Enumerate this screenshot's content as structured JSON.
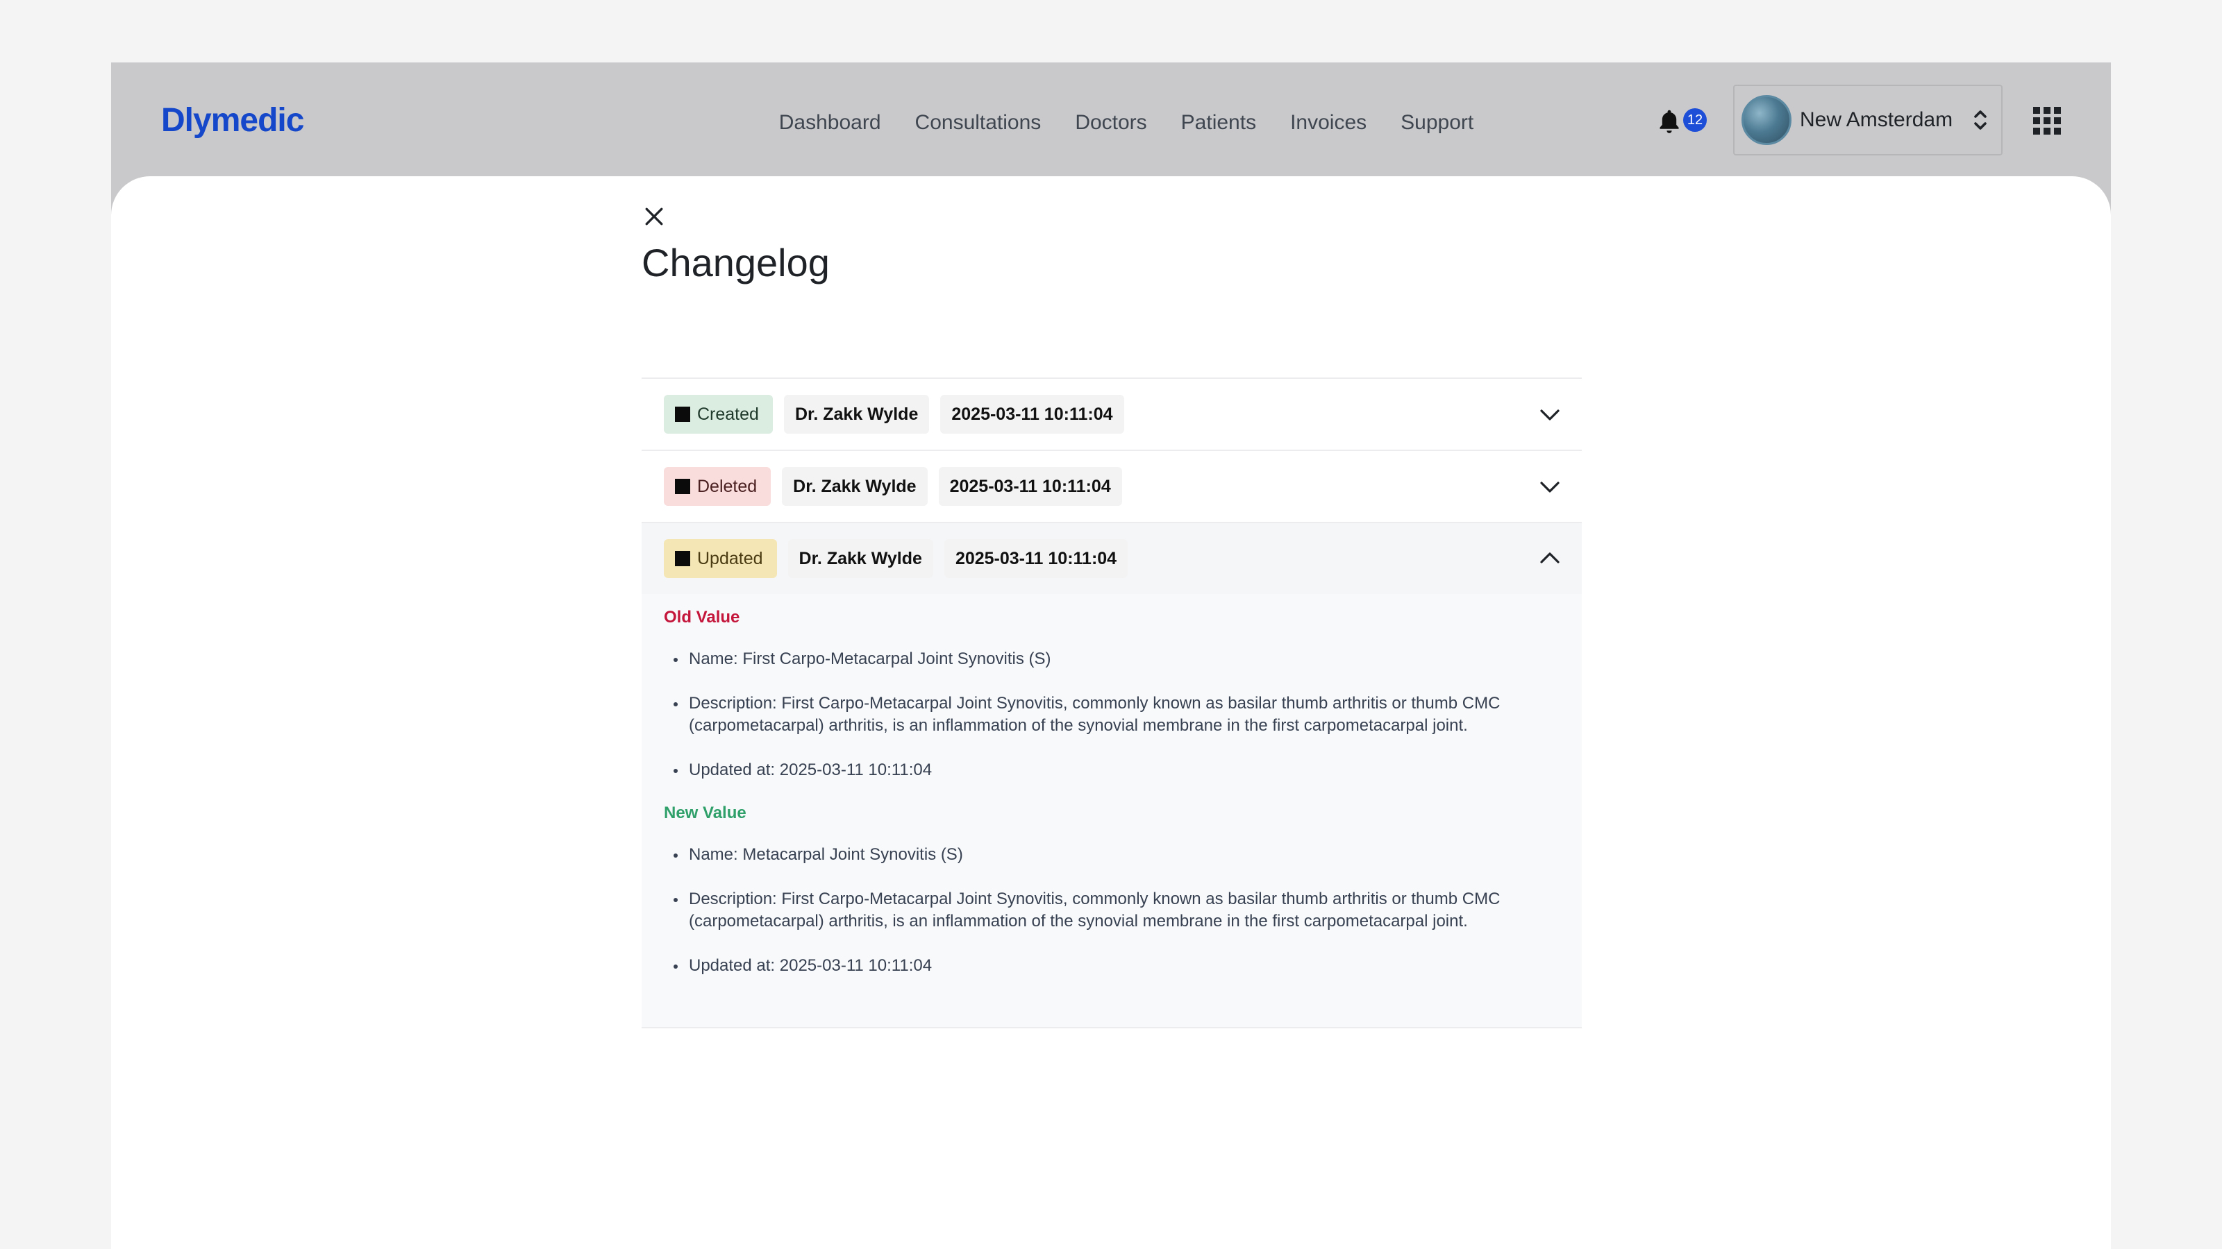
{
  "header": {
    "logo": "Dlymedic",
    "nav": [
      "Dashboard",
      "Consultations",
      "Doctors",
      "Patients",
      "Invoices",
      "Support"
    ],
    "notifications_count": "12",
    "account_name": "New Amsterdam",
    "icons": {
      "bell": "bell-icon",
      "account_switch": "chevron-up-down-icon",
      "apps": "grid-icon"
    }
  },
  "panel": {
    "title": "Changelog",
    "close_icon": "close-icon"
  },
  "entries": [
    {
      "type": "Created",
      "author": "Dr. Zakk Wylde",
      "timestamp": "2025-03-11 10:11:04",
      "expanded": false
    },
    {
      "type": "Deleted",
      "author": "Dr. Zakk Wylde",
      "timestamp": "2025-03-11 10:11:04",
      "expanded": false
    },
    {
      "type": "Updated",
      "author": "Dr. Zakk Wylde",
      "timestamp": "2025-03-11 10:11:04",
      "expanded": true,
      "old_label": "Old Value",
      "old": [
        "Name: First Carpo-Metacarpal Joint Synovitis (S)",
        "Description: First Carpo-Metacarpal Joint Synovitis, commonly known as basilar thumb arthritis or thumb CMC (carpometacarpal) arthritis, is an inflammation of the synovial membrane in the first carpometacarpal joint.",
        "Updated at: 2025-03-11 10:11:04"
      ],
      "new_label": "New Value",
      "new": [
        "Name: Metacarpal Joint Synovitis (S)",
        "Description: First Carpo-Metacarpal Joint Synovitis, commonly known as basilar thumb arthritis or thumb CMC (carpometacarpal) arthritis, is an inflammation of the synovial membrane in the first carpometacarpal joint.",
        "Updated at: 2025-03-11 10:11:04"
      ]
    }
  ],
  "colors": {
    "brand": "#1447c9",
    "created_bg": "#dbece1",
    "deleted_bg": "#f9dcdc",
    "updated_bg": "#f5e6b6",
    "old_value": "#c4163b",
    "new_value": "#2fa06a",
    "badge": "#1d4ed8"
  }
}
